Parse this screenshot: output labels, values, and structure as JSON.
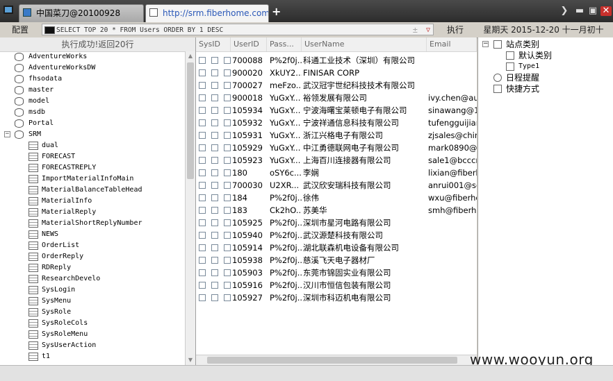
{
  "tabs": [
    {
      "label": "中国菜刀@20100928",
      "active": false
    },
    {
      "label": "http://srm.fiberhome.com.cn/...",
      "active": true
    }
  ],
  "new_tab": "+",
  "window": {
    "more": "❯",
    "minimize": "▬",
    "maximize": "▣",
    "close": "✕"
  },
  "toolbar": {
    "config_label": "配置",
    "sql_query": "SELECT TOP 20 * FROM Users ORDER BY 1 DESC",
    "clear_symbol": "±",
    "dropdown_symbol": "▽",
    "execute_label": "执行",
    "date_text": "星期天 2015-12-20 十一月初十"
  },
  "status_text": "执行成功!返回20行",
  "tree": [
    {
      "label": "AdventureWorks",
      "level": 0
    },
    {
      "label": "AdventureWorksDW",
      "level": 0
    },
    {
      "label": "fhsodata",
      "level": 0
    },
    {
      "label": "master",
      "level": 0
    },
    {
      "label": "model",
      "level": 0
    },
    {
      "label": "msdb",
      "level": 0
    },
    {
      "label": "Portal",
      "level": 0
    },
    {
      "label": "SRM",
      "level": 0,
      "expanded": true
    },
    {
      "label": "dual",
      "level": 1
    },
    {
      "label": "FORECAST",
      "level": 1
    },
    {
      "label": "FORECASTREPLY",
      "level": 1
    },
    {
      "label": "ImportMaterialInfoMain",
      "level": 1
    },
    {
      "label": "MaterialBalanceTableHead",
      "level": 1
    },
    {
      "label": "MaterialInfo",
      "level": 1
    },
    {
      "label": "MaterialReply",
      "level": 1
    },
    {
      "label": "MaterialShortReplyNumber",
      "level": 1
    },
    {
      "label": "NEWS",
      "level": 1
    },
    {
      "label": "OrderList",
      "level": 1
    },
    {
      "label": "OrderReply",
      "level": 1
    },
    {
      "label": "RDReply",
      "level": 1
    },
    {
      "label": "ResearchDevelo",
      "level": 1
    },
    {
      "label": "SysLogin",
      "level": 1
    },
    {
      "label": "SysMenu",
      "level": 1
    },
    {
      "label": "SysRole",
      "level": 1
    },
    {
      "label": "SysRoleCols",
      "level": 1
    },
    {
      "label": "SysRoleMenu",
      "level": 1
    },
    {
      "label": "SysUserAction",
      "level": 1
    },
    {
      "label": "t1",
      "level": 1
    }
  ],
  "grid": {
    "columns": [
      "SysID",
      "UserID",
      "Pass...",
      "UserName",
      "Email"
    ],
    "rows": [
      {
        "userid": "700088",
        "pass": "P%2f0j...",
        "username": "科通工业技术（深圳）有限公司",
        "email": ""
      },
      {
        "userid": "900020",
        "pass": "XkUY2...",
        "username": "FINISAR CORP",
        "email": ""
      },
      {
        "userid": "700027",
        "pass": "meFzo...",
        "username": "武汉冠宇世纪科技技术有限公司",
        "email": ""
      },
      {
        "userid": "900018",
        "pass": "YuGxY...",
        "username": "裕领发展有限公司",
        "email": "ivy.chen@aui-l"
      },
      {
        "userid": "105934",
        "pass": "YuGxY...",
        "username": "宁波海曙宝莱顿电子有限公司",
        "email": "sinawang@163"
      },
      {
        "userid": "105932",
        "pass": "YuGxY...",
        "username": "宁波祥通信息科技有限公司",
        "email": "tufengguijiang("
      },
      {
        "userid": "105931",
        "pass": "YuGxY...",
        "username": "浙江兴格电子有限公司",
        "email": "zjsales@china-"
      },
      {
        "userid": "105929",
        "pass": "YuGxY...",
        "username": "中江勇德联网电子有限公司",
        "email": "mark0890@ud"
      },
      {
        "userid": "105923",
        "pass": "YuGxY...",
        "username": "上海百川连接器有限公司",
        "email": "sale1@bcccn."
      },
      {
        "userid": "180",
        "pass": "oSY6c...",
        "username": "李娴",
        "email": "lixian@fiberhor"
      },
      {
        "userid": "700030",
        "pass": "U2XR...",
        "username": "武汉欣安瑞科技有限公司",
        "email": "anrui001@soh"
      },
      {
        "userid": "184",
        "pass": "P%2f0j...",
        "username": "徐伟",
        "email": "wxu@fiberhom"
      },
      {
        "userid": "183",
        "pass": "Ck2hO...",
        "username": "苏美华",
        "email": "smh@fiberhom"
      },
      {
        "userid": "105925",
        "pass": "P%2f0j...",
        "username": "深圳市星河电路有限公司",
        "email": ""
      },
      {
        "userid": "105940",
        "pass": "P%2f0j...",
        "username": "武汉源楚科技有限公司",
        "email": ""
      },
      {
        "userid": "105914",
        "pass": "P%2f0j...",
        "username": "湖北联森机电设备有限公司",
        "email": ""
      },
      {
        "userid": "105938",
        "pass": "P%2f0j...",
        "username": "慈溪飞天电子器材厂",
        "email": ""
      },
      {
        "userid": "105903",
        "pass": "P%2f0j...",
        "username": "东莞市锦固实业有限公司",
        "email": ""
      },
      {
        "userid": "105916",
        "pass": "P%2f0j...",
        "username": "汉川市恒信包装有限公司",
        "email": ""
      },
      {
        "userid": "105927",
        "pass": "P%2f0j...",
        "username": "深圳市科迈机电有限公司",
        "email": ""
      }
    ]
  },
  "sidebar": {
    "site_category": "站点类别",
    "default_category": "默认类别",
    "type1": "Type1",
    "schedule_reminder": "日程提醒",
    "shortcuts": "快捷方式"
  },
  "watermark": "www.wooyun.org",
  "colors": {
    "tab_active_text": "#2a58b8",
    "close_button": "#c8302c",
    "chrome": "#d4d0c8"
  }
}
